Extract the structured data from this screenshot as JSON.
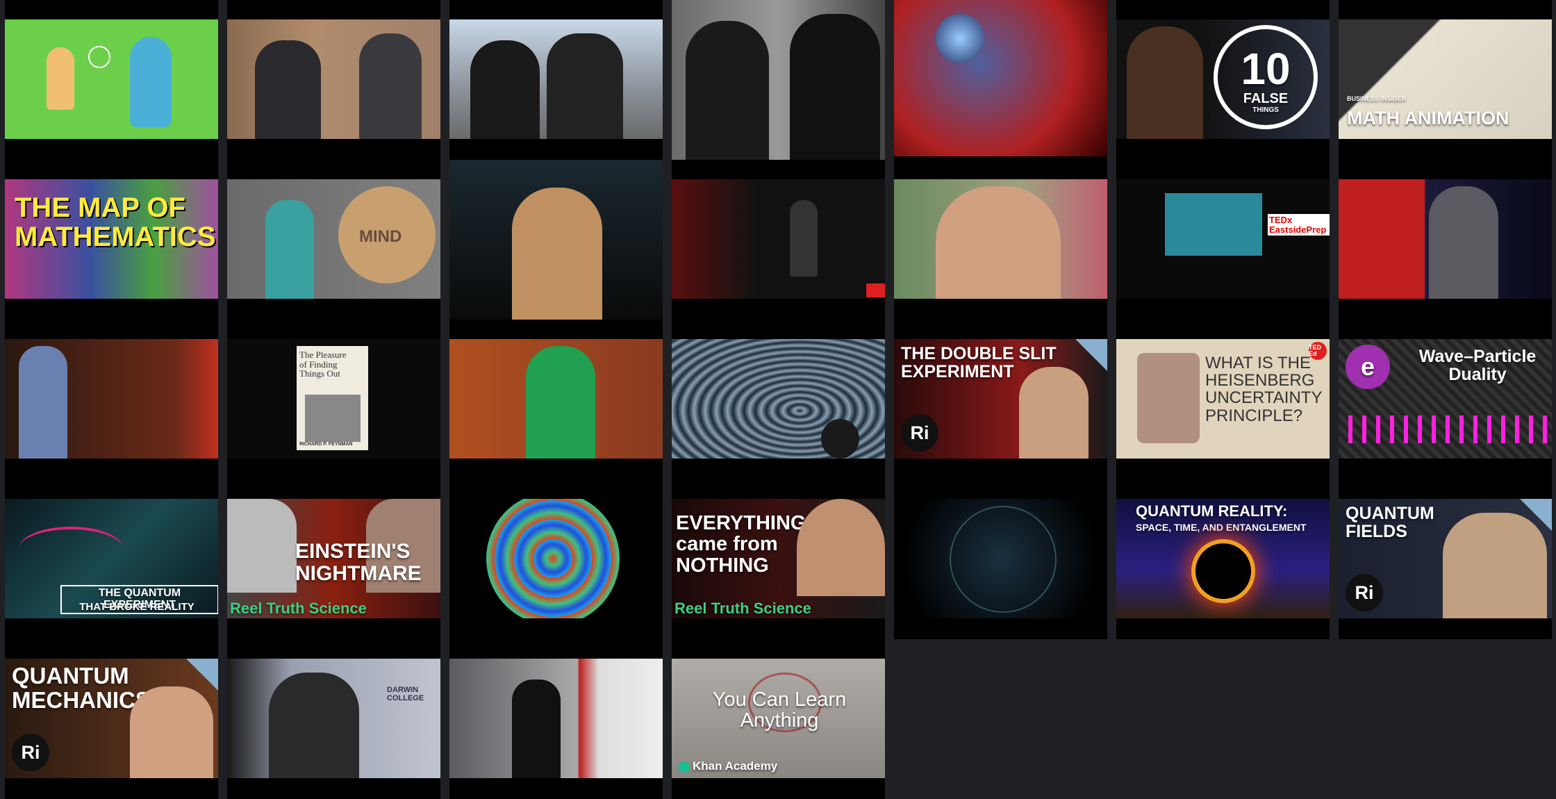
{
  "videos": [
    {
      "thumb_text": ""
    },
    {
      "thumb_text": ""
    },
    {
      "thumb_text": ""
    },
    {
      "thumb_text": ""
    },
    {
      "thumb_text": ""
    },
    {
      "thumb_text": "10",
      "thumb_sub": "FALSE",
      "thumb_sub2": "THINGS"
    },
    {
      "thumb_text": "MATH ANIMATION",
      "thumb_sub": "BUSINESS INSIDER"
    },
    {
      "thumb_text": "THE MAP OF MATHEMATICS"
    },
    {
      "thumb_text": "MIND"
    },
    {
      "thumb_text": ""
    },
    {
      "thumb_text": ""
    },
    {
      "thumb_text": ""
    },
    {
      "thumb_text": "TEDx EastsidePrep"
    },
    {
      "thumb_text": ""
    },
    {
      "thumb_text": ""
    },
    {
      "thumb_text": "The Pleasure of Finding Things Out",
      "thumb_sub": "RICHARD P. FEYNMAN"
    },
    {
      "thumb_text": ""
    },
    {
      "thumb_text": ""
    },
    {
      "thumb_text": "THE DOUBLE SLIT EXPERIMENT",
      "badge": "Ri"
    },
    {
      "thumb_text": "WHAT IS THE HEISENBERG UNCERTAINTY PRINCIPLE?",
      "badge": "TED Ed"
    },
    {
      "thumb_text": "Wave–Particle Duality",
      "badge": "e"
    },
    {
      "thumb_text": "THE QUANTUM EXPERIMENT",
      "thumb_sub": "THAT BROKE REALITY"
    },
    {
      "thumb_text": "EINSTEIN'S NIGHTMARE",
      "thumb_sub": "Reel Truth Science"
    },
    {
      "thumb_text": ""
    },
    {
      "thumb_text": "EVERYTHING came from NOTHING",
      "thumb_sub": "Reel Truth Science"
    },
    {
      "thumb_text": ""
    },
    {
      "thumb_text": "QUANTUM REALITY:",
      "thumb_sub": "SPACE, TIME, AND ENTANGLEMENT"
    },
    {
      "thumb_text": "QUANTUM FIELDS",
      "badge": "Ri"
    },
    {
      "thumb_text": "QUANTUM MECHANICS",
      "badge": "Ri"
    },
    {
      "thumb_text": "DARWIN COLLEGE"
    },
    {
      "thumb_text": ""
    },
    {
      "thumb_text": "You Can Learn Anything",
      "thumb_sub": "Khan Academy"
    }
  ],
  "colors": {
    "background": "#1f2023",
    "tile": "#000000",
    "ri_badge": "#111111",
    "ri_accent": "#4aa0d0"
  }
}
